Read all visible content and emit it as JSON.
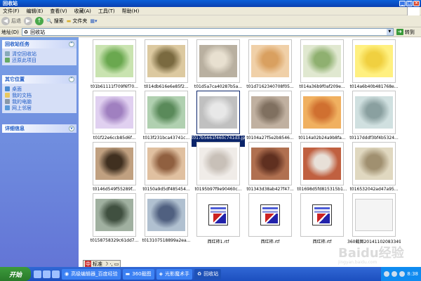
{
  "window": {
    "title": "回收站"
  },
  "menu": [
    "文件(F)",
    "编辑(E)",
    "查看(V)",
    "收藏(A)",
    "工具(T)",
    "帮助(H)"
  ],
  "toolbar": {
    "back": "后退",
    "search": "搜索",
    "folders": "文件夹"
  },
  "address": {
    "label": "地址(D)",
    "value": "回收站",
    "go": "转到"
  },
  "sidebar": {
    "tasks": {
      "title": "回收站任务",
      "items": [
        "清空回收站",
        "还原此项目"
      ]
    },
    "places": {
      "title": "其它位置",
      "items": [
        "桌面",
        "我的文档",
        "我的电脑",
        "网上邻居"
      ]
    },
    "details": {
      "title": "详细信息"
    }
  },
  "files": [
    "t01b61111f709f6f70...",
    "t014db616e6e85f2...",
    "t01d5a7ca40287b5a...",
    "t01d7162340708f05...",
    "t014a36b9f0af209e...",
    "t014a6b40b481768e...",
    "t01f22e6ccb85d6f...",
    "t013f231bca43741c...",
    "t017b5661f460c741d3.jpg",
    "t0104a27f5e2b8546...",
    "t0114a02b24a9b8fa...",
    "t0117dddf3bf4b5324...",
    "t0146d549f55289f...",
    "t0150a9d5df485454...",
    "t0195b97f9e90460c...",
    "t01343d38ab427f47...",
    "t01698d5fd815315b1...",
    "t016532042ad47a95...",
    "t0158758329c61dd7...",
    "t013107518899a2ea...",
    "西红柿1.rtf",
    "西红柿.rtf",
    "西红柿.rtf",
    "360截图20141102083349281..."
  ],
  "ime": {
    "mode": "标准"
  },
  "taskbar": {
    "start": "开始",
    "tasks": [
      "高级编辑器_百度经验",
      "360截图",
      "光影魔术手",
      "回收站"
    ],
    "time": "8:38"
  },
  "watermark": {
    "brand": "Baidu经验",
    "url": "jingyan.baidu.com"
  },
  "colors": {
    "xp_blue": "#0a5fd8",
    "selection": "#0a246a",
    "sidebar": "#6375d6"
  }
}
